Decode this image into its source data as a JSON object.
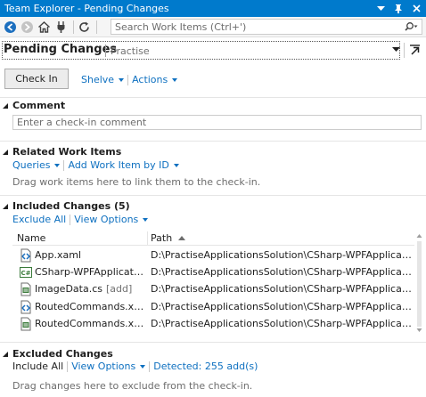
{
  "window": {
    "title": "Team Explorer - Pending Changes"
  },
  "toolbar": {
    "search_placeholder": "Search Work Items (Ctrl+')"
  },
  "header": {
    "title": "Pending Changes",
    "context": "Practise"
  },
  "actions": {
    "check_in_label": "Check In",
    "shelve_label": "Shelve",
    "actions_label": "Actions"
  },
  "comment": {
    "title": "Comment",
    "placeholder": "Enter a check-in comment"
  },
  "related": {
    "title": "Related Work Items",
    "queries_label": "Queries",
    "add_label": "Add Work Item by ID",
    "hint": "Drag work items here to link them to the check-in."
  },
  "included": {
    "title": "Included Changes (5)",
    "exclude_all_label": "Exclude All",
    "view_options_label": "View Options",
    "columns": {
      "name": "Name",
      "path": "Path"
    },
    "rows": [
      {
        "name": "App.xaml",
        "state": "",
        "path": "D:\\PractiseApplicationsSolution\\CSharp-WPFApplication",
        "icon": "xaml-file-icon"
      },
      {
        "name": "CSharp-WPFApplicatio...",
        "state": "",
        "path": "D:\\PractiseApplicationsSolution\\CSharp-WPFApplication",
        "icon": "csharp-project-icon"
      },
      {
        "name": "ImageData.cs",
        "state": "[add]",
        "path": "D:\\PractiseApplicationsSolution\\CSharp-WPFApplication\\Ro...",
        "icon": "cs-file-icon"
      },
      {
        "name": "RoutedCommands.xa...",
        "state": "",
        "path": "D:\\PractiseApplicationsSolution\\CSharp-WPFApplication\\Ro...",
        "icon": "xaml-file-icon"
      },
      {
        "name": "RoutedCommands.xa...",
        "state": "",
        "path": "D:\\PractiseApplicationsSolution\\CSharp-WPFApplication\\Ro...",
        "icon": "cs-file-icon"
      }
    ]
  },
  "excluded": {
    "title": "Excluded Changes",
    "include_all_label": "Include All",
    "view_options_label": "View Options",
    "detected_label": "Detected: 255 add(s)",
    "hint": "Drag changes here to exclude from the check-in."
  },
  "colors": {
    "accent": "#007acc",
    "link": "#0e70c0",
    "toolbar_bg": "#f5f5f5"
  }
}
